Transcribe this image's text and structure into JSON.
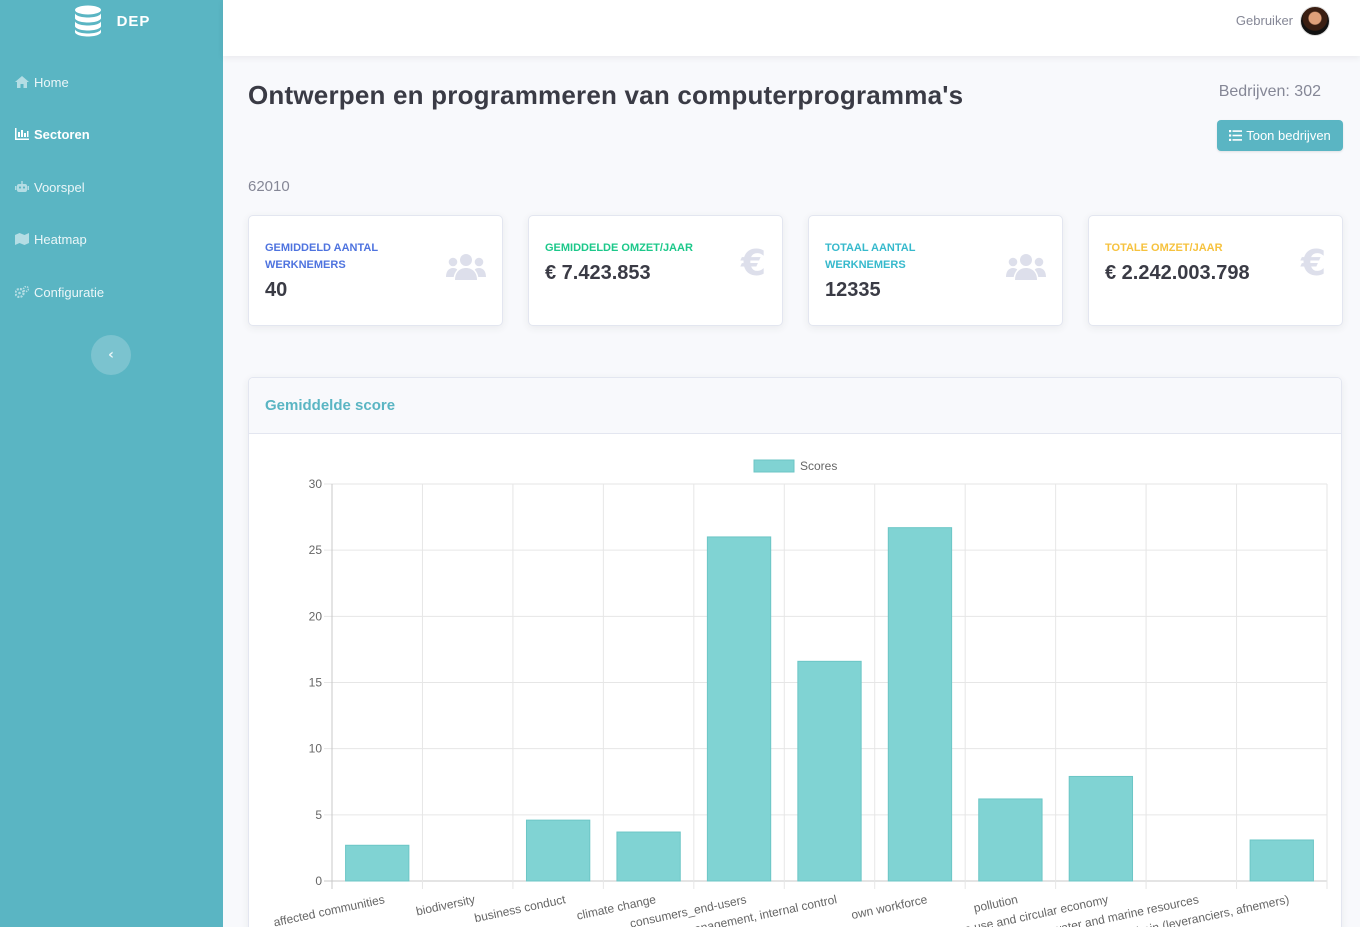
{
  "brand": {
    "name": "DEP",
    "icon": "database-icon"
  },
  "sidebar": {
    "items": [
      {
        "label": "Home",
        "icon": "home-icon",
        "active": false
      },
      {
        "label": "Sectoren",
        "icon": "bar-chart-icon",
        "active": true
      },
      {
        "label": "Voorspel",
        "icon": "robot-icon",
        "active": false
      },
      {
        "label": "Heatmap",
        "icon": "map-icon",
        "active": false
      },
      {
        "label": "Configuratie",
        "icon": "cogs-icon",
        "active": false
      }
    ],
    "toggle_icon": "chevron-left-icon"
  },
  "topbar": {
    "user_name": "Gebruiker",
    "avatar_icon": "user-avatar"
  },
  "page": {
    "title": "Ontwerpen en programmeren van computerprogramma's",
    "companies_count": "Bedrijven: 302",
    "button_label": "Toon bedrijven",
    "button_icon": "list-icon",
    "sector_code": "62010"
  },
  "cards": [
    {
      "label": "Gemiddeld aantal werknemers",
      "value": "40",
      "icon": "users-icon",
      "color": "#4e73df"
    },
    {
      "label": "Gemiddelde omzet/jaar",
      "value": "€ 7.423.853",
      "icon": "euro-icon",
      "color": "#1cc88a"
    },
    {
      "label": "Totaal aantal werknemers",
      "value": "12335",
      "icon": "users-icon",
      "color": "#36b9cc"
    },
    {
      "label": "Totale omzet/jaar",
      "value": "€ 2.242.003.798",
      "icon": "euro-icon",
      "color": "#f6c23e"
    }
  ],
  "panel": {
    "title": "Gemiddelde score"
  },
  "colors": {
    "sidebar": "#5ab5c3",
    "bar_fill": "#80d3d3",
    "bar_stroke": "#6cc6c6"
  },
  "chart_data": {
    "type": "bar",
    "legend": "Scores",
    "legend_position": "top",
    "grid": true,
    "ylim": [
      0,
      30
    ],
    "yticks": [
      0,
      5,
      10,
      15,
      20,
      25,
      30
    ],
    "categories": [
      "affected communities",
      "biodiversity",
      "business conduct",
      "climate change",
      "consumers_end-users",
      "management, internal control",
      "own workforce",
      "pollution",
      "resource use and circular economy",
      "water and marine resources",
      "workers in the value chain (leveranciers, afnemers)"
    ],
    "series": [
      {
        "name": "Scores",
        "values": [
          2.7,
          0,
          4.6,
          3.7,
          26.0,
          16.6,
          26.7,
          6.2,
          7.9,
          0,
          3.1
        ]
      }
    ]
  }
}
